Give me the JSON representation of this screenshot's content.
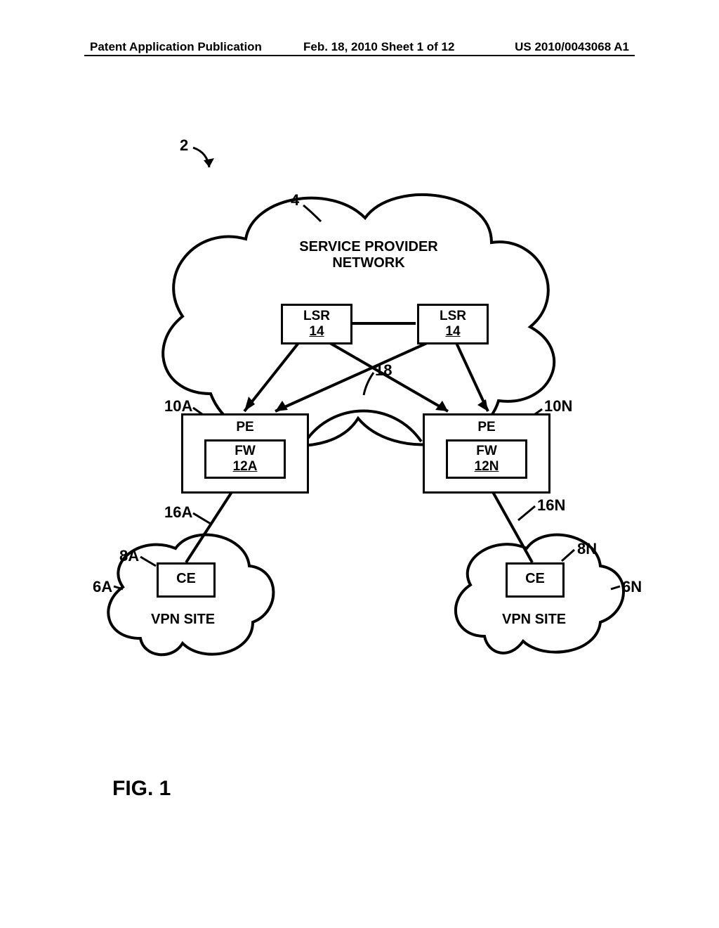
{
  "header": {
    "left": "Patent Application Publication",
    "center": "Feb. 18, 2010  Sheet 1 of 12",
    "right": "US 2010/0043068 A1"
  },
  "refs": {
    "system": "2",
    "spn_cloud": "4",
    "vpn_left": "6A",
    "vpn_right": "6N",
    "ce_left": "8A",
    "ce_right": "8N",
    "pe_left": "10A",
    "pe_right": "10N",
    "link_left": "16A",
    "link_right": "16N",
    "tunnel": "18"
  },
  "labels": {
    "spn": "SERVICE PROVIDER NETWORK",
    "lsr": "LSR",
    "lsr_num": "14",
    "pe": "PE",
    "fw": "FW",
    "fw_left": "12A",
    "fw_right": "12N",
    "ce": "CE",
    "vpn_site": "VPN SITE"
  },
  "figure": "FIG. 1"
}
